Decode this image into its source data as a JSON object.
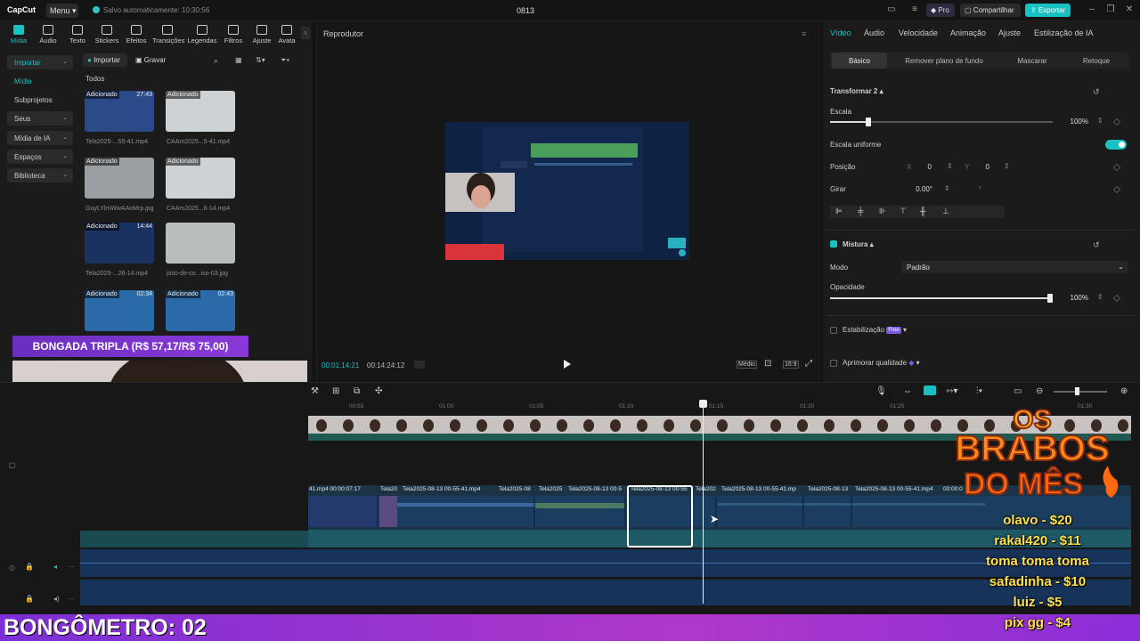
{
  "app": {
    "logo": "CapCut",
    "menu_label": "Menu",
    "autosave": "Salvo automaticamente: 10:30:56",
    "project_title": "0813"
  },
  "header_buttons": {
    "pro": "Pro",
    "share": "Compartilhar",
    "export": "Exportar"
  },
  "categories": [
    "Mídia",
    "Áudio",
    "Texto",
    "Stickers",
    "Efeitos",
    "Transições",
    "Legendas",
    "Filtros",
    "Ajuste",
    "Avata"
  ],
  "sidenav": [
    {
      "label": "Importar",
      "chev": "⌄"
    },
    {
      "label": "Mídia",
      "chev": ""
    },
    {
      "label": "Subprojetos",
      "chev": ""
    },
    {
      "label": "Seus",
      "chev": "⌄"
    },
    {
      "label": "Mídia de IA",
      "chev": "⌄"
    },
    {
      "label": "Espaços",
      "chev": "⌄"
    },
    {
      "label": "Biblioteca",
      "chev": "⌄"
    }
  ],
  "media_toolbar": {
    "import": "Importar",
    "record": "Gravar",
    "section": "Todos"
  },
  "media_items": [
    {
      "tag": "Adicionado",
      "duration": "27:43",
      "name": "Tela2025-...55-41.mp4",
      "color": "#2b4a8a"
    },
    {
      "tag": "Adicionado",
      "duration": "",
      "name": "CAAm2025...5-41.mp4",
      "color": "#cfd2d4"
    },
    {
      "tag": "Adicionado",
      "duration": "",
      "name": "GuyLYlmWwAAoMrp.jpg",
      "color": "#9a9fa4"
    },
    {
      "tag": "Adicionado",
      "duration": "",
      "name": "CAAm2025...6-14.mp4",
      "color": "#cfd2d4"
    },
    {
      "tag": "Adicionado",
      "duration": "14:44",
      "name": "Tela2025-...26-14.mp4",
      "color": "#1a3260"
    },
    {
      "tag": "",
      "duration": "",
      "name": "piso-de-co...iso-03.jpg",
      "color": "#b9bdbe"
    },
    {
      "tag": "Adicionado",
      "duration": "02:34",
      "name": "",
      "color": "#2a6aa8"
    },
    {
      "tag": "Adicionado",
      "duration": "02:43",
      "name": "",
      "color": "#2a6aa8"
    }
  ],
  "overlay": {
    "banner": "BONGADA TRIPLA (R$ 57,17/R$ 75,00)",
    "brabos_line1": "OS",
    "brabos_line2": "BRABOS",
    "brabos_line3": "DO MÊS",
    "donors": [
      "olavo - $20",
      "rakal420 - $11",
      "toma toma toma",
      "safadinha - $10",
      "luiz - $5",
      "pix gg - $4"
    ],
    "bongometro": "BONGÔMETRO: 02"
  },
  "player": {
    "title": "Reprodutor",
    "current_time": "00:01:14:21",
    "total_time": "00:14:24:12",
    "quality": "Médio",
    "ratio": "16:9"
  },
  "inspector": {
    "tabs": [
      "Vídeo",
      "Áudio",
      "Velocidade",
      "Animação",
      "Ajuste",
      "Estilização de IA"
    ],
    "subtabs": [
      "Básico",
      "Remover plano de fundo",
      "Mascarar",
      "Retoque"
    ],
    "transform_title": "Transformar 2",
    "scale_label": "Escala",
    "scale_value": "100%",
    "scale_level": 0.17,
    "uniform_label": "Escala uniforme",
    "position_label": "Posição",
    "pos_x_label": "X",
    "pos_x": "0",
    "pos_y_label": "Y",
    "pos_y": "0",
    "rotate_label": "Girar",
    "rotate_value": "0.00°",
    "blend_title": "Mistura",
    "mode_label": "Modo",
    "mode_value": "Padrão",
    "opacity_label": "Opacidade",
    "opacity_value": "100%",
    "opacity_level": 1.0,
    "stabilize_label": "Estabilização",
    "stabilize_badge": "Free",
    "quality_label": "Aprimorar qualidade"
  },
  "timeline": {
    "ruler": [
      "00:55",
      "01:00",
      "01:05",
      "01:10",
      "01:15",
      "01:20",
      "01:25",
      "01:30"
    ],
    "clip_labels": [
      "41.mp4  00:00:07:17",
      "Tela20",
      "Tela2025-08-13 00-55-41.mp4",
      "Tela2025-08",
      "Tela2025",
      "Tela2025-08-13 00-5",
      "Tela2025-08-13 00-55",
      "Tela202",
      "Tela2025-08-13 00-55-41.mp",
      "Tela2025-08-13",
      "Tela2025-08-13 00-55-41.mp4",
      "00:00:0"
    ]
  },
  "colors": {
    "accent": "#19c2c2",
    "banner": "#7b2fd6",
    "donor_text": "#ffe04a"
  }
}
